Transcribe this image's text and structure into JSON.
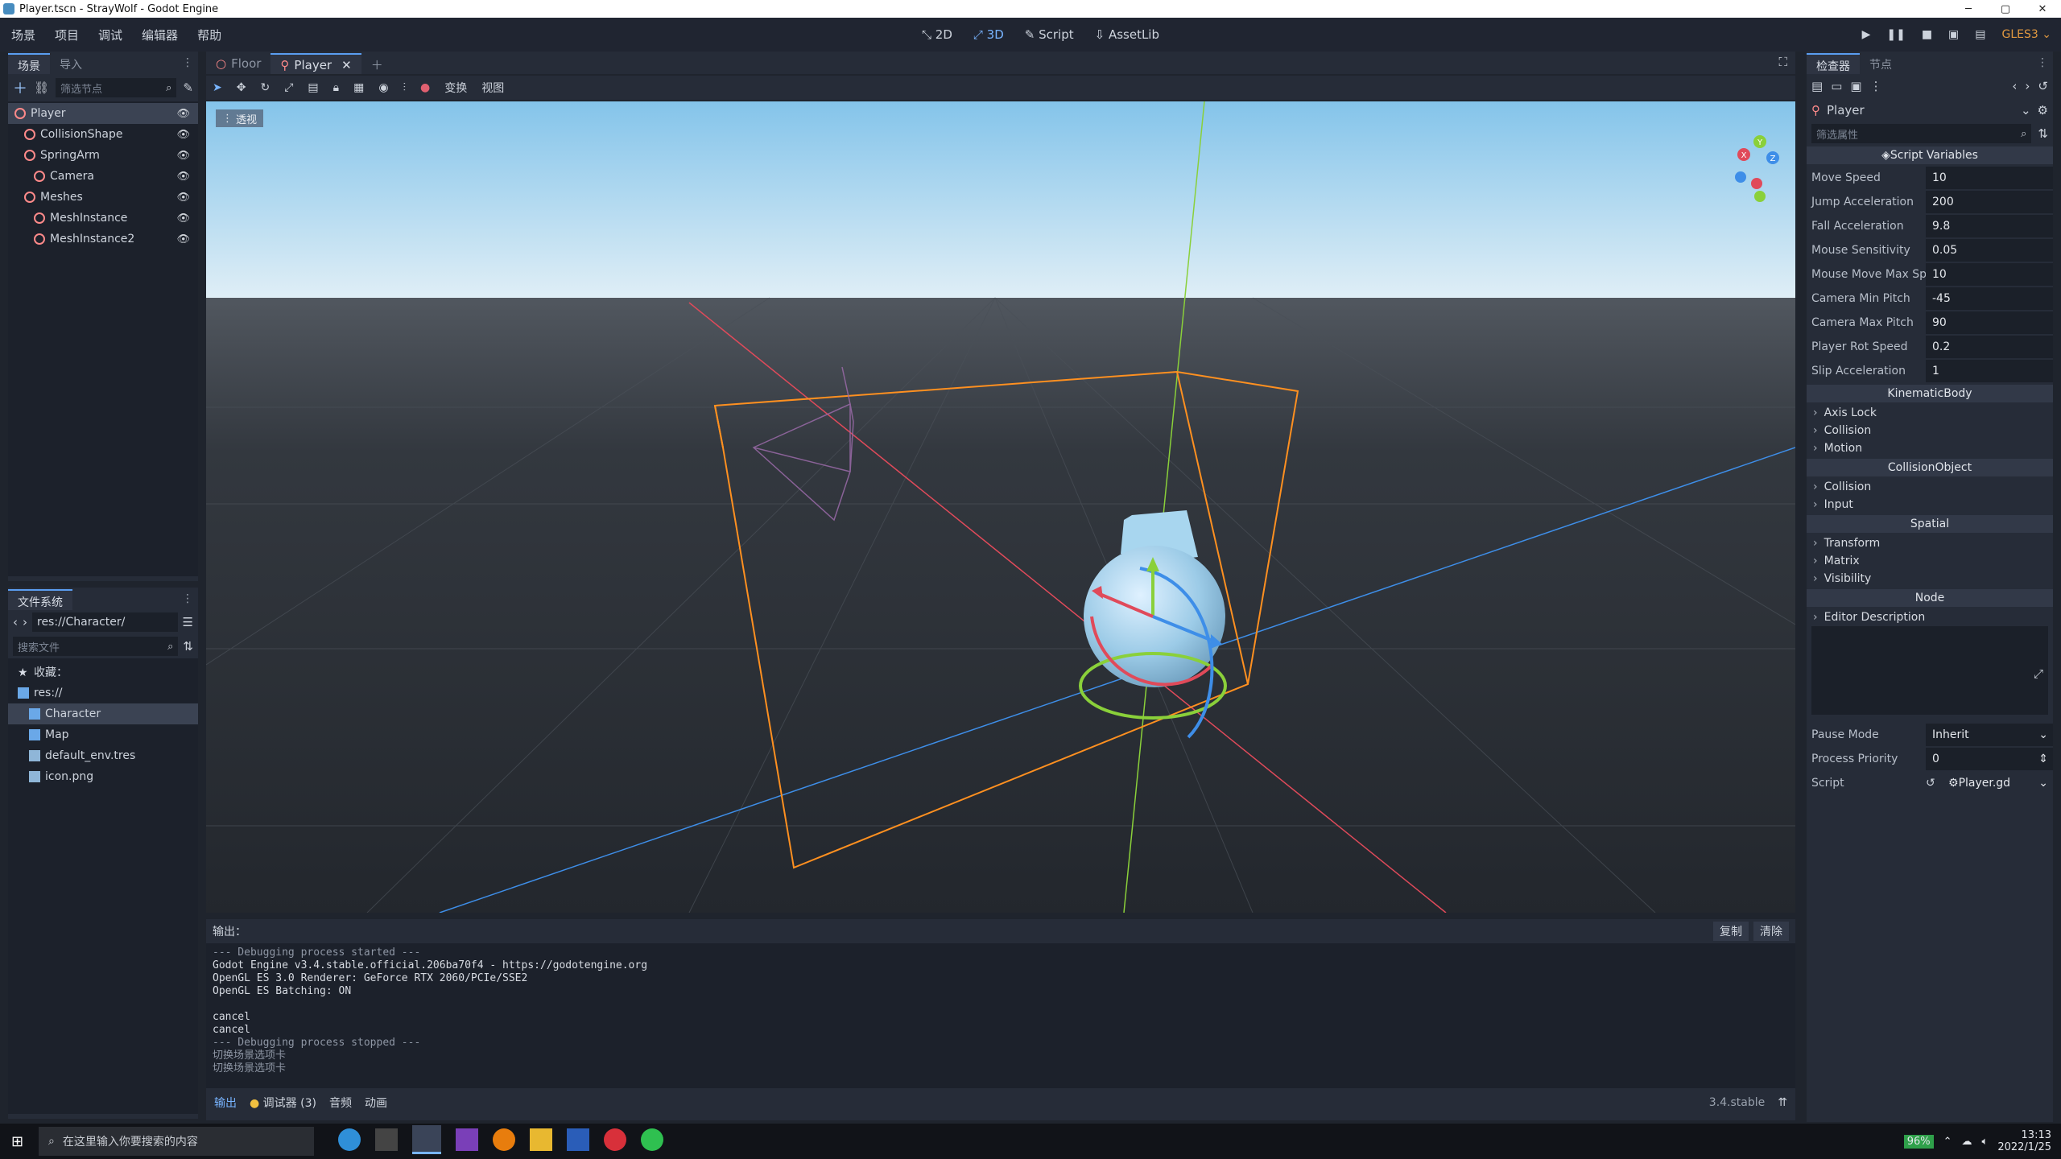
{
  "window": {
    "title": "Player.tscn - StrayWolf - Godot Engine",
    "controls": [
      "─",
      "▢",
      "✕"
    ]
  },
  "menu": {
    "items": [
      "场景",
      "项目",
      "调试",
      "编辑器",
      "帮助"
    ],
    "modes": [
      {
        "label": "2D",
        "icon": "2d-icon"
      },
      {
        "label": "3D",
        "icon": "3d-icon",
        "active": true
      },
      {
        "label": "Script",
        "icon": "script-icon"
      },
      {
        "label": "AssetLib",
        "icon": "assetlib-icon"
      }
    ],
    "renderer": "GLES3"
  },
  "scene_dock": {
    "tabs": [
      "场景",
      "导入"
    ],
    "filter_placeholder": "筛选节点",
    "nodes": [
      {
        "label": "Player",
        "depth": 0,
        "selected": true,
        "color": "#ff8a8a"
      },
      {
        "label": "CollisionShape",
        "depth": 1,
        "color": "#ff8a8a"
      },
      {
        "label": "SpringArm",
        "depth": 1,
        "color": "#ff8a8a"
      },
      {
        "label": "Camera",
        "depth": 2,
        "color": "#ff8a8a"
      },
      {
        "label": "Meshes",
        "depth": 1,
        "color": "#ff8a8a"
      },
      {
        "label": "MeshInstance",
        "depth": 2,
        "color": "#ff8a8a"
      },
      {
        "label": "MeshInstance2",
        "depth": 2,
        "color": "#ff8a8a"
      }
    ]
  },
  "fs_dock": {
    "title": "文件系统",
    "path": "res://Character/",
    "search_placeholder": "搜索文件",
    "items": [
      {
        "label": "收藏：",
        "depth": 0,
        "icon": "star-icon"
      },
      {
        "label": "res://",
        "depth": 0,
        "icon": "folder-icon"
      },
      {
        "label": "Character",
        "depth": 1,
        "icon": "folder-icon",
        "selected": true
      },
      {
        "label": "Map",
        "depth": 1,
        "icon": "folder-icon"
      },
      {
        "label": "default_env.tres",
        "depth": 1,
        "icon": "env-icon"
      },
      {
        "label": "icon.png",
        "depth": 1,
        "icon": "image-icon"
      }
    ]
  },
  "editor_tabs": [
    {
      "label": "Floor",
      "active": false
    },
    {
      "label": "Player",
      "active": true
    }
  ],
  "viewport_toolbar": {
    "transform": "变换",
    "view": "视图"
  },
  "viewport": {
    "perspective_label": "透视",
    "gizmo_axes": [
      "Y",
      "X",
      "Z"
    ]
  },
  "inspector": {
    "tabs": [
      "检查器",
      "节点"
    ],
    "node_name": "Player",
    "filter_placeholder": "筛选属性",
    "script_section": "Script Variables",
    "script_vars": [
      {
        "label": "Move Speed",
        "value": "10"
      },
      {
        "label": "Jump Acceleration",
        "value": "200"
      },
      {
        "label": "Fall Acceleration",
        "value": "9.8"
      },
      {
        "label": "Mouse Sensitivity",
        "value": "0.05"
      },
      {
        "label": "Mouse Move Max Sp",
        "value": "10"
      },
      {
        "label": "Camera Min Pitch",
        "value": "-45"
      },
      {
        "label": "Camera Max Pitch",
        "value": "90"
      },
      {
        "label": "Player Rot Speed",
        "value": "0.2"
      },
      {
        "label": "Slip Acceleration",
        "value": "1"
      }
    ],
    "sections": [
      {
        "title": "KinematicBody",
        "children": [
          "Axis Lock",
          "Collision",
          "Motion"
        ]
      },
      {
        "title": "CollisionObject",
        "children": [
          "Collision",
          "Input"
        ]
      },
      {
        "title": "Spatial",
        "children": [
          "Transform",
          "Matrix",
          "Visibility"
        ]
      },
      {
        "title": "Node",
        "children": []
      }
    ],
    "editor_description": "Editor Description",
    "pause_mode": {
      "label": "Pause Mode",
      "value": "Inherit"
    },
    "process_priority": {
      "label": "Process Priority",
      "value": "0"
    },
    "script": {
      "label": "Script",
      "value": "Player.gd"
    }
  },
  "output": {
    "title": "输出：",
    "copy": "复制",
    "clear": "清除",
    "lines": [
      "--- Debugging process started ---",
      "Godot Engine v3.4.stable.official.206ba70f4 - https://godotengine.org",
      "OpenGL ES 3.0 Renderer: GeForce RTX 2060/PCIe/SSE2",
      "OpenGL ES Batching: ON",
      "",
      "cancel",
      "cancel",
      "--- Debugging process stopped ---",
      "切换场景选项卡",
      "切换场景选项卡"
    ],
    "bottom_tabs": [
      "输出",
      "调试器 (3)",
      "音频",
      "动画"
    ],
    "version": "3.4.stable"
  },
  "taskbar": {
    "search_placeholder": "在这里输入你要搜索的内容",
    "battery": "96%",
    "time": "13:13",
    "date": "2022/1/25"
  },
  "colors": {
    "accent": "#5a9df0",
    "bg": "#1f242d",
    "panel": "#262c38",
    "x_axis": "#e04a5a",
    "y_axis": "#8ad03a",
    "z_axis": "#3e8ee8",
    "selection": "#ff9020"
  }
}
